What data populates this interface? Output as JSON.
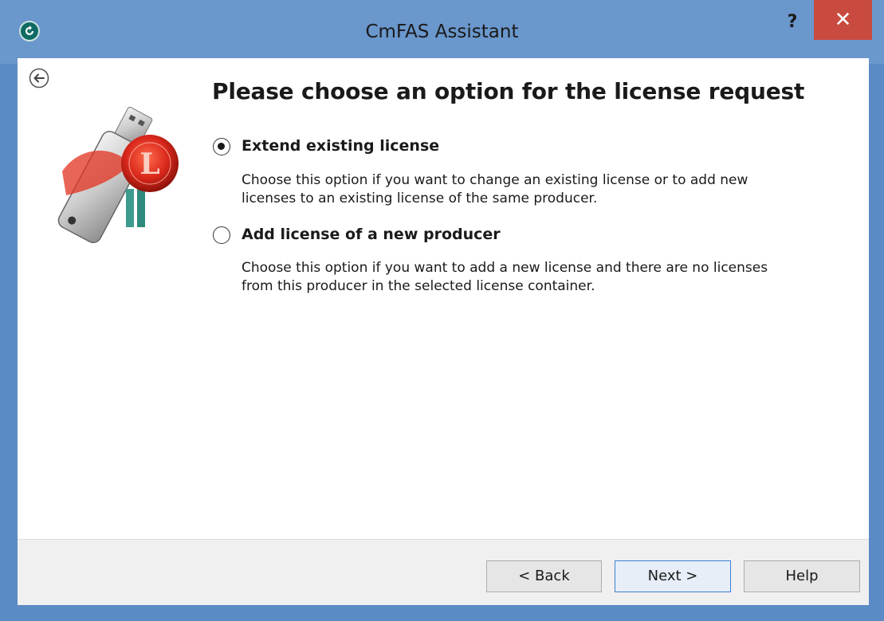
{
  "window": {
    "title": "CmFAS Assistant",
    "help_label": "?",
    "close_label": "✕"
  },
  "page": {
    "heading": "Please choose an option for the license request",
    "back_icon": "back-arrow-icon"
  },
  "options": [
    {
      "label": "Extend existing license",
      "selected": true,
      "description_lines": [
        "Choose this option if you want to change an existing license or to add new",
        "licenses to an existing license of the same producer."
      ]
    },
    {
      "label": "Add license of a new producer",
      "selected": false,
      "description_lines": [
        "Choose this option if you want to add a new license and there are no licenses",
        "from this producer in the selected license container."
      ]
    }
  ],
  "buttons": {
    "back": "< Back",
    "next": "Next >",
    "help": "Help"
  },
  "colors": {
    "frame": "#6a97cc",
    "close": "#c94a3f",
    "seal": "#d9281c"
  }
}
